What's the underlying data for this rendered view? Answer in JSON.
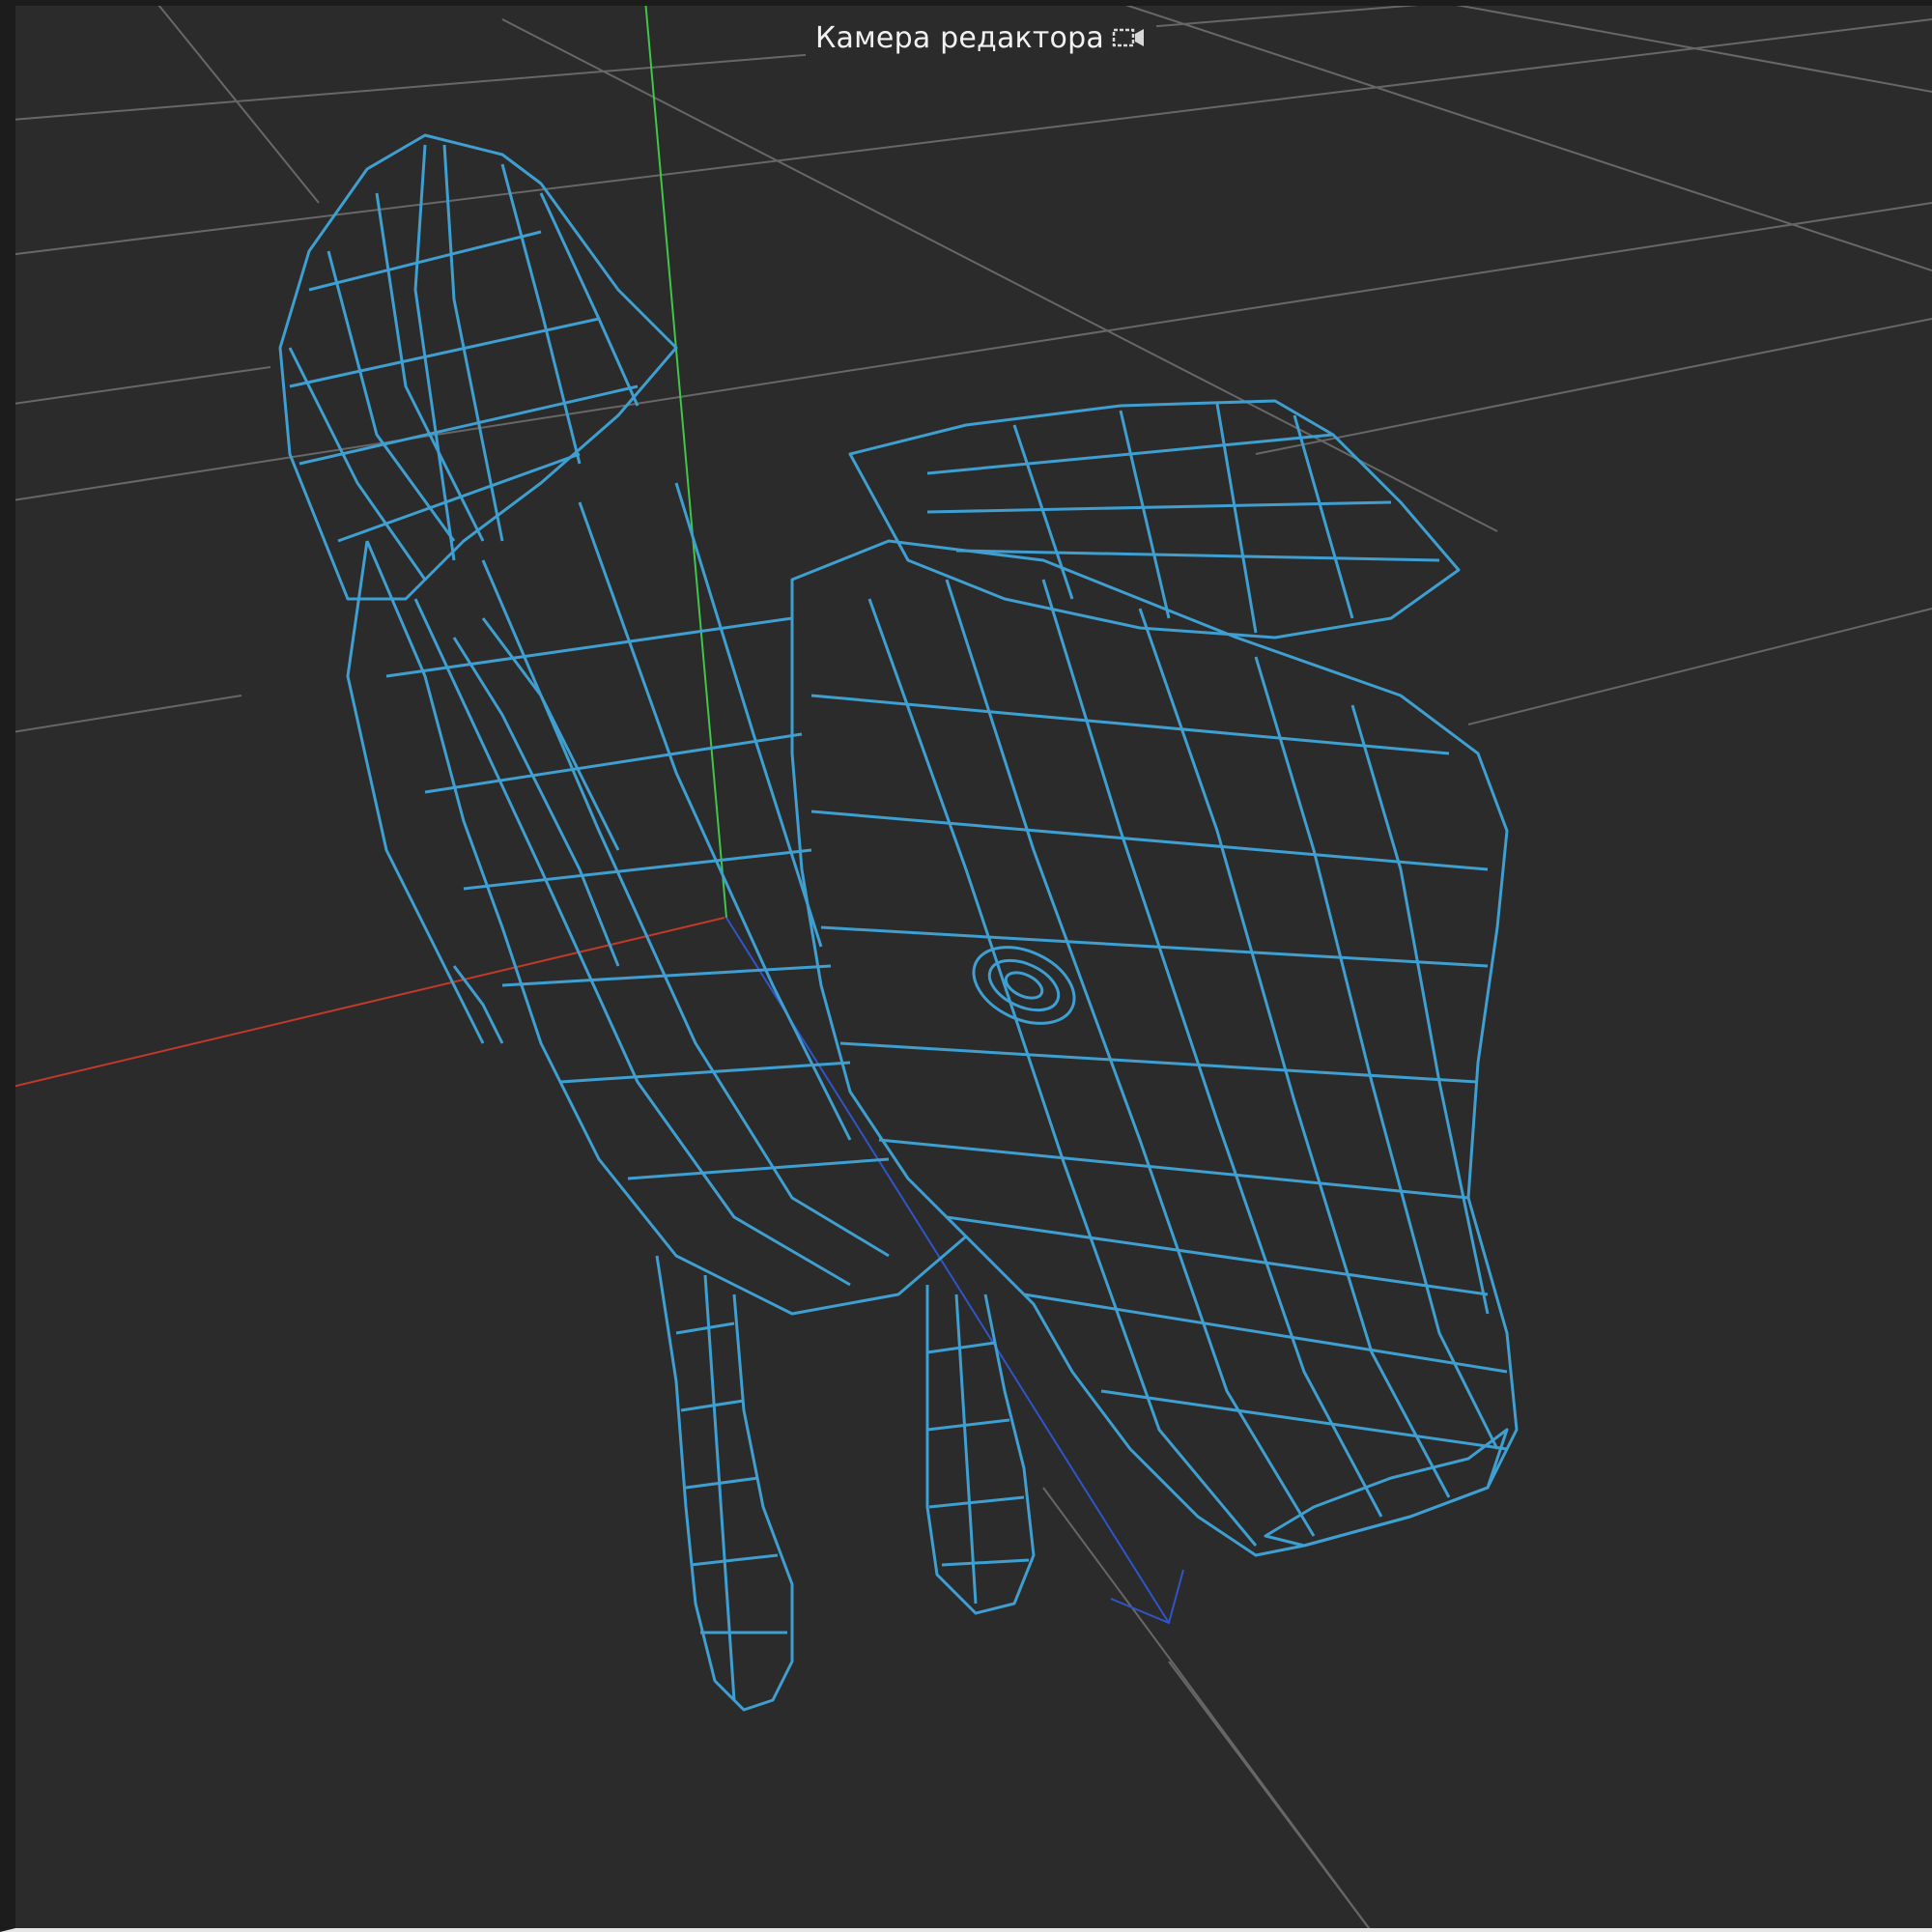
{
  "viewport": {
    "camera_label": "Камера редактора",
    "camera_icon": "camera-icon",
    "background_color": "#2b2b2b"
  },
  "scene": {
    "object": "wireframe-mesh",
    "render_mode": "wireframe",
    "mesh_color": "#3e9fd0",
    "grid_color": "#7a7a7a",
    "axes": {
      "x_color": "#c0392b",
      "y_color": "#3ec74a",
      "z_color": "#2f55c8"
    }
  }
}
